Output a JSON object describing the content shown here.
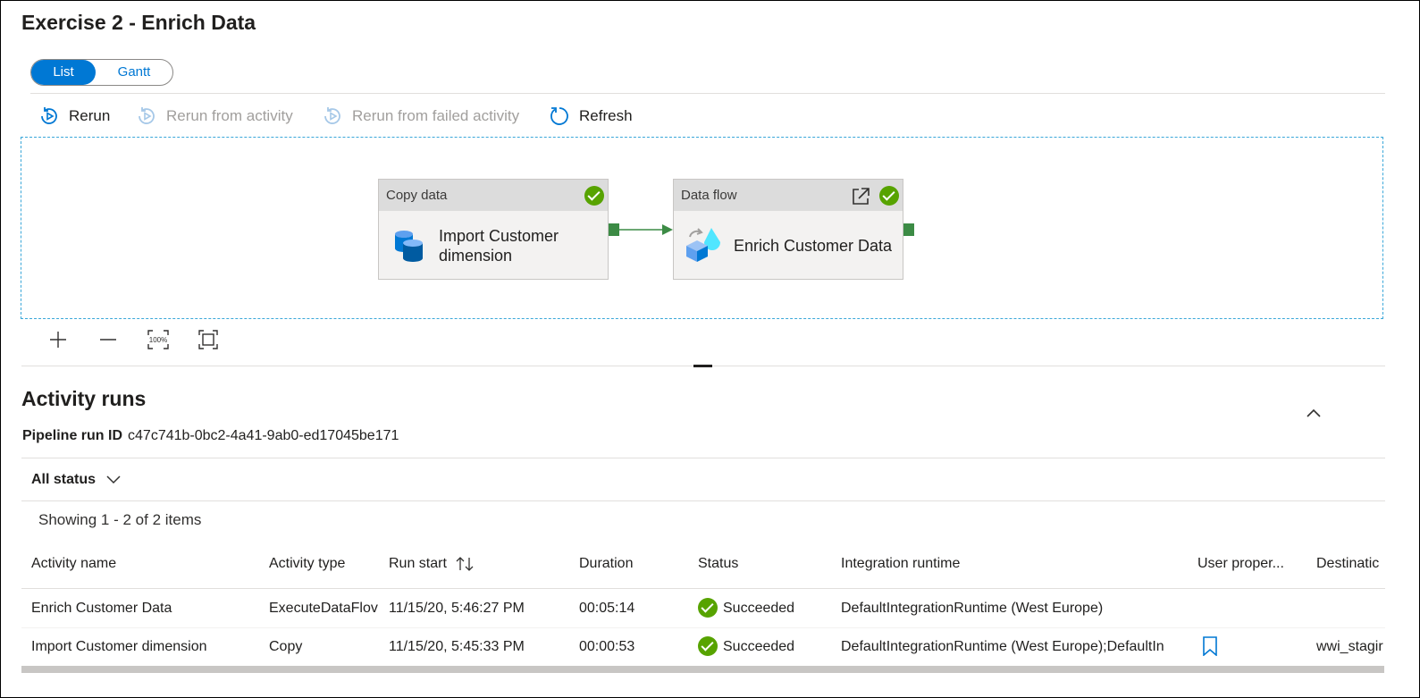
{
  "page": {
    "title": "Exercise 2 - Enrich Data"
  },
  "view_toggle": {
    "list_label": "List",
    "gantt_label": "Gantt"
  },
  "toolbar": {
    "rerun": "Rerun",
    "rerun_from_activity": "Rerun from activity",
    "rerun_from_failed": "Rerun from failed activity",
    "refresh": "Refresh"
  },
  "pipeline": {
    "activities": [
      {
        "type_label": "Copy data",
        "name_line1": "Import Customer",
        "name_line2": "dimension",
        "status": "succeeded"
      },
      {
        "type_label": "Data flow",
        "name": "Enrich Customer Data",
        "status": "succeeded"
      }
    ]
  },
  "activity_runs": {
    "heading": "Activity runs",
    "pipeline_run_id_label": "Pipeline run ID",
    "pipeline_run_id": "c47c741b-0bc2-4a41-9ab0-ed17045be171",
    "filter_label": "All status",
    "showing_text": "Showing 1 - 2 of 2 items",
    "columns": [
      "Activity name",
      "Activity type",
      "Run start",
      "Duration",
      "Status",
      "Integration runtime",
      "User proper...",
      "Destinatic"
    ],
    "rows": [
      {
        "name": "Enrich Customer Data",
        "type": "ExecuteDataFlov",
        "run_start": "11/15/20, 5:46:27 PM",
        "duration": "00:05:14",
        "status": "Succeeded",
        "runtime": "DefaultIntegrationRuntime (West Europe)",
        "destination": ""
      },
      {
        "name": "Import Customer dimension",
        "type": "Copy",
        "run_start": "11/15/20, 5:45:33 PM",
        "duration": "00:00:53",
        "status": "Succeeded",
        "runtime": "DefaultIntegrationRuntime (West Europe);DefaultIn",
        "destination": "wwi_stagir"
      }
    ]
  },
  "colors": {
    "accent": "#0078d4",
    "success": "#57a300",
    "port": "#3c8b45"
  }
}
